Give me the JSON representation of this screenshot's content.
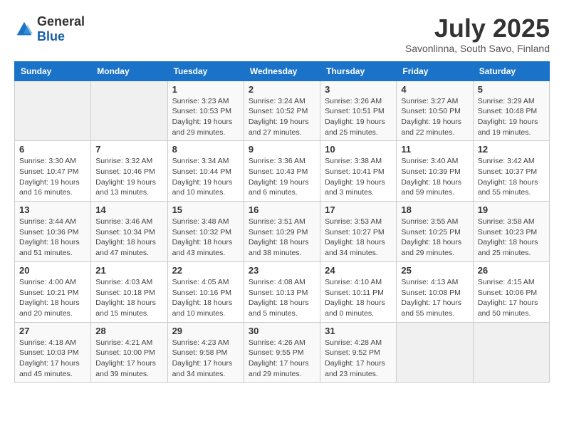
{
  "logo": {
    "general": "General",
    "blue": "Blue"
  },
  "title": {
    "month_year": "July 2025",
    "location": "Savonlinna, South Savo, Finland"
  },
  "headers": [
    "Sunday",
    "Monday",
    "Tuesday",
    "Wednesday",
    "Thursday",
    "Friday",
    "Saturday"
  ],
  "weeks": [
    [
      {
        "day": "",
        "detail": ""
      },
      {
        "day": "",
        "detail": ""
      },
      {
        "day": "1",
        "detail": "Sunrise: 3:23 AM\nSunset: 10:53 PM\nDaylight: 19 hours\nand 29 minutes."
      },
      {
        "day": "2",
        "detail": "Sunrise: 3:24 AM\nSunset: 10:52 PM\nDaylight: 19 hours\nand 27 minutes."
      },
      {
        "day": "3",
        "detail": "Sunrise: 3:26 AM\nSunset: 10:51 PM\nDaylight: 19 hours\nand 25 minutes."
      },
      {
        "day": "4",
        "detail": "Sunrise: 3:27 AM\nSunset: 10:50 PM\nDaylight: 19 hours\nand 22 minutes."
      },
      {
        "day": "5",
        "detail": "Sunrise: 3:29 AM\nSunset: 10:48 PM\nDaylight: 19 hours\nand 19 minutes."
      }
    ],
    [
      {
        "day": "6",
        "detail": "Sunrise: 3:30 AM\nSunset: 10:47 PM\nDaylight: 19 hours\nand 16 minutes."
      },
      {
        "day": "7",
        "detail": "Sunrise: 3:32 AM\nSunset: 10:46 PM\nDaylight: 19 hours\nand 13 minutes."
      },
      {
        "day": "8",
        "detail": "Sunrise: 3:34 AM\nSunset: 10:44 PM\nDaylight: 19 hours\nand 10 minutes."
      },
      {
        "day": "9",
        "detail": "Sunrise: 3:36 AM\nSunset: 10:43 PM\nDaylight: 19 hours\nand 6 minutes."
      },
      {
        "day": "10",
        "detail": "Sunrise: 3:38 AM\nSunset: 10:41 PM\nDaylight: 19 hours\nand 3 minutes."
      },
      {
        "day": "11",
        "detail": "Sunrise: 3:40 AM\nSunset: 10:39 PM\nDaylight: 18 hours\nand 59 minutes."
      },
      {
        "day": "12",
        "detail": "Sunrise: 3:42 AM\nSunset: 10:37 PM\nDaylight: 18 hours\nand 55 minutes."
      }
    ],
    [
      {
        "day": "13",
        "detail": "Sunrise: 3:44 AM\nSunset: 10:36 PM\nDaylight: 18 hours\nand 51 minutes."
      },
      {
        "day": "14",
        "detail": "Sunrise: 3:46 AM\nSunset: 10:34 PM\nDaylight: 18 hours\nand 47 minutes."
      },
      {
        "day": "15",
        "detail": "Sunrise: 3:48 AM\nSunset: 10:32 PM\nDaylight: 18 hours\nand 43 minutes."
      },
      {
        "day": "16",
        "detail": "Sunrise: 3:51 AM\nSunset: 10:29 PM\nDaylight: 18 hours\nand 38 minutes."
      },
      {
        "day": "17",
        "detail": "Sunrise: 3:53 AM\nSunset: 10:27 PM\nDaylight: 18 hours\nand 34 minutes."
      },
      {
        "day": "18",
        "detail": "Sunrise: 3:55 AM\nSunset: 10:25 PM\nDaylight: 18 hours\nand 29 minutes."
      },
      {
        "day": "19",
        "detail": "Sunrise: 3:58 AM\nSunset: 10:23 PM\nDaylight: 18 hours\nand 25 minutes."
      }
    ],
    [
      {
        "day": "20",
        "detail": "Sunrise: 4:00 AM\nSunset: 10:21 PM\nDaylight: 18 hours\nand 20 minutes."
      },
      {
        "day": "21",
        "detail": "Sunrise: 4:03 AM\nSunset: 10:18 PM\nDaylight: 18 hours\nand 15 minutes."
      },
      {
        "day": "22",
        "detail": "Sunrise: 4:05 AM\nSunset: 10:16 PM\nDaylight: 18 hours\nand 10 minutes."
      },
      {
        "day": "23",
        "detail": "Sunrise: 4:08 AM\nSunset: 10:13 PM\nDaylight: 18 hours\nand 5 minutes."
      },
      {
        "day": "24",
        "detail": "Sunrise: 4:10 AM\nSunset: 10:11 PM\nDaylight: 18 hours\nand 0 minutes."
      },
      {
        "day": "25",
        "detail": "Sunrise: 4:13 AM\nSunset: 10:08 PM\nDaylight: 17 hours\nand 55 minutes."
      },
      {
        "day": "26",
        "detail": "Sunrise: 4:15 AM\nSunset: 10:06 PM\nDaylight: 17 hours\nand 50 minutes."
      }
    ],
    [
      {
        "day": "27",
        "detail": "Sunrise: 4:18 AM\nSunset: 10:03 PM\nDaylight: 17 hours\nand 45 minutes."
      },
      {
        "day": "28",
        "detail": "Sunrise: 4:21 AM\nSunset: 10:00 PM\nDaylight: 17 hours\nand 39 minutes."
      },
      {
        "day": "29",
        "detail": "Sunrise: 4:23 AM\nSunset: 9:58 PM\nDaylight: 17 hours\nand 34 minutes."
      },
      {
        "day": "30",
        "detail": "Sunrise: 4:26 AM\nSunset: 9:55 PM\nDaylight: 17 hours\nand 29 minutes."
      },
      {
        "day": "31",
        "detail": "Sunrise: 4:28 AM\nSunset: 9:52 PM\nDaylight: 17 hours\nand 23 minutes."
      },
      {
        "day": "",
        "detail": ""
      },
      {
        "day": "",
        "detail": ""
      }
    ]
  ]
}
